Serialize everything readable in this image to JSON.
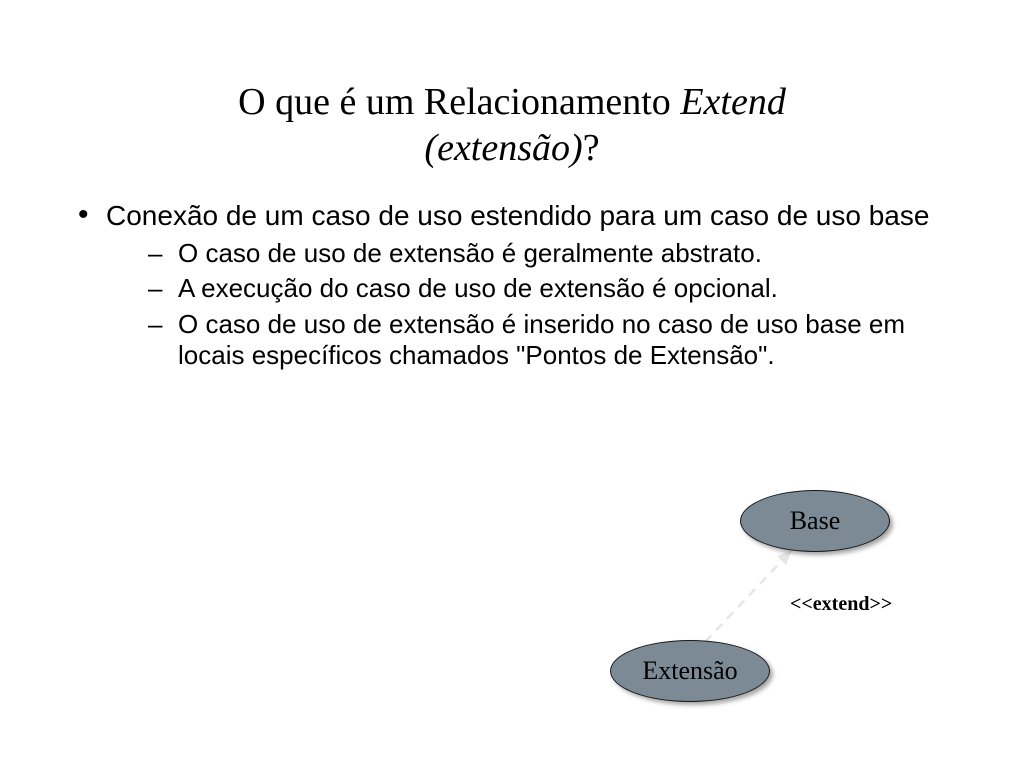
{
  "title": {
    "prefix": "O que é um Relacionamento ",
    "italic1": "Extend ",
    "italic2": "(extensão)",
    "suffix": "?"
  },
  "bullet1": "Conexão de um caso de uso estendido para um caso de uso base",
  "sub1": "O caso de uso de extensão é geralmente abstrato.",
  "sub2": "A execução do caso de uso de extensão é opcional.",
  "sub3": "O caso de uso de extensão é inserido no caso de uso base em locais específicos chamados \"Pontos de Extensão\".",
  "diagram": {
    "base_label": "Base",
    "extension_label": "Extensão",
    "relationship_label": "<<extend>>"
  }
}
